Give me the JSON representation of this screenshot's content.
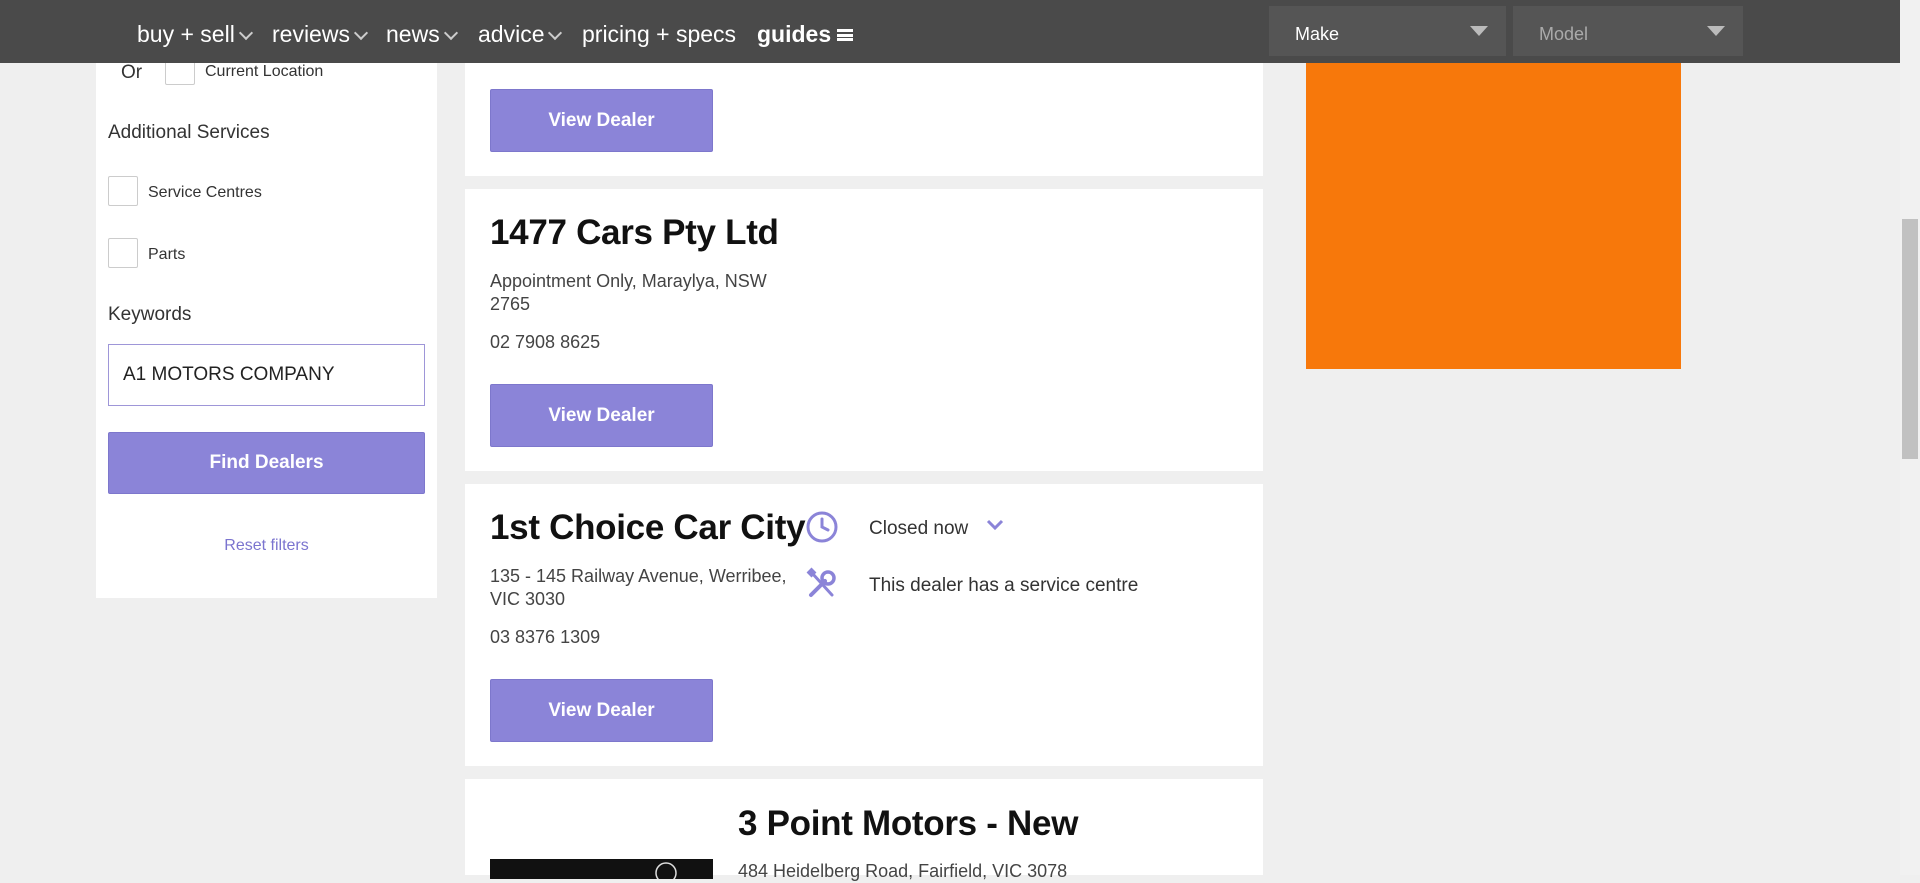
{
  "nav": {
    "items": [
      {
        "label": "buy + sell"
      },
      {
        "label": "reviews"
      },
      {
        "label": "news"
      },
      {
        "label": "advice"
      },
      {
        "label": "pricing + specs"
      },
      {
        "label": "guides"
      }
    ],
    "make_select": "Make",
    "model_select": "Model"
  },
  "sidebar": {
    "or_label": "Or",
    "current_location_label": "Current Location",
    "additional_services_heading": "Additional Services",
    "service_centres_label": "Service Centres",
    "parts_label": "Parts",
    "keywords_heading": "Keywords",
    "keywords_value": "A1 MOTORS COMPANY",
    "find_button": "Find Dealers",
    "reset_link": "Reset filters"
  },
  "dealers": [
    {
      "view_button": "View Dealer"
    },
    {
      "name": "1477 Cars Pty Ltd",
      "address": "Appointment Only, Maraylya, NSW 2765",
      "phone": "02 7908 8625",
      "view_button": "View Dealer"
    },
    {
      "name": "1st Choice Car City",
      "address": "135 - 145 Railway Avenue, Werribee, VIC 3030",
      "phone": "03 8376 1309",
      "hours_status": "Closed now",
      "service_note": "This dealer has a service centre",
      "view_button": "View Dealer"
    },
    {
      "name": "3 Point Motors - New",
      "address": "484 Heidelberg Road, Fairfield, VIC 3078"
    }
  ],
  "colors": {
    "nav_bg": "#4a4a4a",
    "accent": "#8b84d8",
    "ad_orange": "#f7780b",
    "page_bg": "#efefef"
  },
  "icons": [
    "clock-icon",
    "wrench-screwdriver-icon",
    "chevron-down-icon",
    "hamburger-icon"
  ]
}
